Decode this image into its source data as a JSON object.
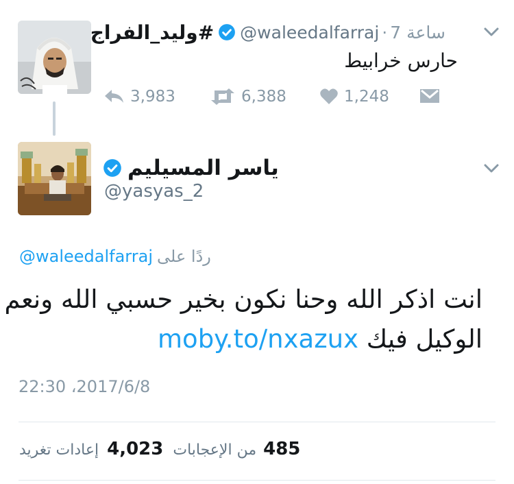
{
  "parent_tweet": {
    "display_name": "وليد_الفراج#",
    "handle": "@waleedalfarraj",
    "separator": "·",
    "time_ago": "7 ساعة",
    "text": "حارس خرابيط",
    "actions": {
      "replies": "3,983",
      "retweets": "6,388",
      "likes": "1,248"
    },
    "icons": {
      "reply": "reply-icon",
      "retweet": "retweet-icon",
      "like": "heart-icon",
      "dm": "envelope-icon",
      "more": "chevron-down-icon",
      "verified": "verified-badge-icon"
    }
  },
  "main_tweet": {
    "display_name": "ياسر المسيليم",
    "handle": "@yasyas_2",
    "reply_prefix": "ردًا على",
    "reply_to": "@waleedalfarraj",
    "text_line1": "انت اذكر الله وحنا نكون بخير حسبي الله ونعم",
    "text_line2_word": "الوكيل فيك",
    "link": "moby.to/nxazux",
    "timestamp": "22:30 ،2017/6/8",
    "stats": {
      "likes_count": "485",
      "likes_label": "من الإعجابات",
      "retweets_count": "4,023",
      "retweets_label": "إعادات تغريد"
    }
  },
  "colors": {
    "link_blue": "#1da1f2",
    "muted_gray": "#8899a6",
    "handle_gray": "#657786",
    "text": "#14171a",
    "divider": "#e1e8ed"
  }
}
